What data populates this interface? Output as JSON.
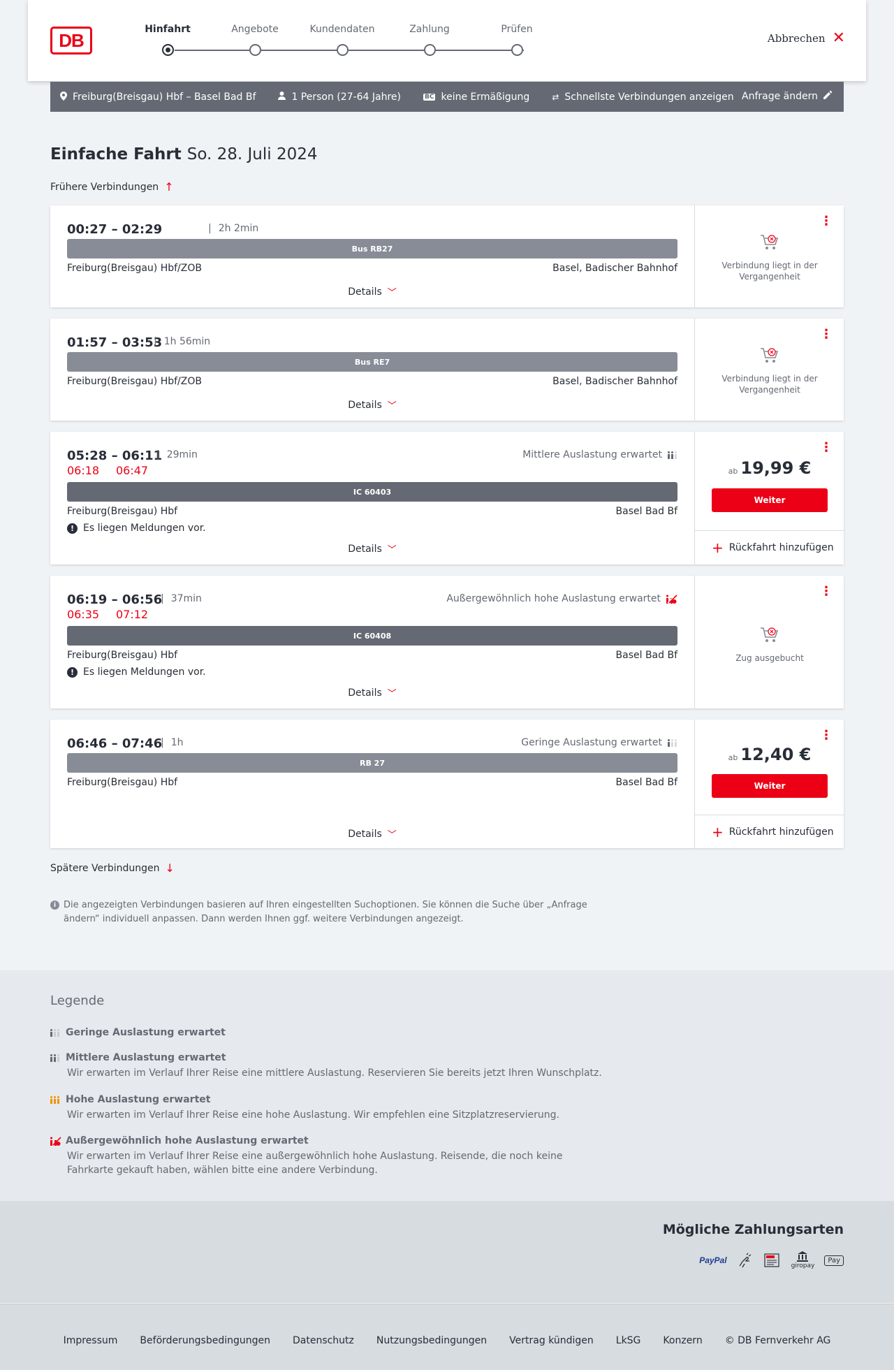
{
  "header": {
    "logo": "DB",
    "steps": [
      {
        "label": "Hinfahrt",
        "active": true
      },
      {
        "label": "Angebote",
        "active": false
      },
      {
        "label": "Kundendaten",
        "active": false
      },
      {
        "label": "Zahlung",
        "active": false
      },
      {
        "label": "Prüfen",
        "active": false
      }
    ],
    "cancel_label": "Abbrechen"
  },
  "search": {
    "route": "Freiburg(Breisgau) Hbf – Basel Bad Bf",
    "persons": "1 Person (27-64 Jahre)",
    "bc_badge": "BC",
    "discount": "keine Ermäßigung",
    "option": "Schnellste Verbindungen anzeigen",
    "change_label": "Anfrage ändern"
  },
  "title": {
    "trip_type": "Einfache Fahrt",
    "date": "So. 28. Juli 2024"
  },
  "earlier_label": "Frühere Verbindungen",
  "later_label": "Spätere Verbindungen",
  "connections": [
    {
      "times": "00:27 – 02:29",
      "duration": "2h 2min",
      "train": "Bus RB27",
      "from": "Freiburg(Breisgau) Hbf/ZOB",
      "to": "Basel, Badischer Bahnhof",
      "details": "Details",
      "status": "Verbindung liegt in der Vergangenheit"
    },
    {
      "times": "01:57 – 03:53",
      "duration": "1h 56min",
      "train": "Bus RE7",
      "from": "Freiburg(Breisgau) Hbf/ZOB",
      "to": "Basel, Badischer Bahnhof",
      "details": "Details",
      "status": "Verbindung liegt in der Vergangenheit"
    },
    {
      "times": "05:28 – 06:11",
      "duration": "29min",
      "delay_dep": "06:18",
      "delay_arr": "06:47",
      "occupancy": "Mittlere Auslastung erwartet",
      "train": "IC 60403",
      "from": "Freiburg(Breisgau) Hbf",
      "to": "Basel Bad Bf",
      "message": "Es liegen Meldungen vor.",
      "details": "Details",
      "price_prefix": "ab",
      "price": "19,99 €",
      "button": "Weiter",
      "return_label": "Rückfahrt hinzufügen"
    },
    {
      "times": "06:19 – 06:56",
      "duration": "37min",
      "delay_dep": "06:35",
      "delay_arr": "07:12",
      "occupancy": "Außergewöhnlich hohe Auslastung erwartet",
      "train": "IC 60408",
      "from": "Freiburg(Breisgau) Hbf",
      "to": "Basel Bad Bf",
      "message": "Es liegen Meldungen vor.",
      "details": "Details",
      "status": "Zug ausgebucht"
    },
    {
      "times": "06:46 – 07:46",
      "duration": "1h",
      "occupancy": "Geringe Auslastung erwartet",
      "train": "RB 27",
      "from": "Freiburg(Breisgau) Hbf",
      "to": "Basel Bad Bf",
      "details": "Details",
      "price_prefix": "ab",
      "price": "12,40 €",
      "button": "Weiter",
      "return_label": "Rückfahrt hinzufügen"
    }
  ],
  "info_text": "Die angezeigten Verbindungen basieren auf Ihren eingestellten Suchoptionen. Sie können die Suche über „Anfrage ändern“ individuell anpassen. Dann werden Ihnen ggf. weitere Verbindungen angezeigt.",
  "legend": {
    "title": "Legende",
    "items": [
      {
        "title": "Geringe Auslastung erwartet",
        "desc": ""
      },
      {
        "title": "Mittlere Auslastung erwartet",
        "desc": "Wir erwarten im Verlauf Ihrer Reise eine mittlere Auslastung. Reservieren Sie bereits jetzt Ihren Wunschplatz."
      },
      {
        "title": "Hohe Auslastung erwartet",
        "desc": "Wir erwarten im Verlauf Ihrer Reise eine hohe Auslastung. Wir empfehlen eine Sitzplatzreservierung."
      },
      {
        "title": "Außergewöhnlich hohe Auslastung erwartet",
        "desc": "Wir erwarten im Verlauf Ihrer Reise eine außergewöhnlich hohe Auslastung. Reisende, die noch keine Fahrkarte gekauft haben, wählen bitte eine andere Verbindung."
      }
    ]
  },
  "payments": {
    "title": "Mögliche Zahlungsarten",
    "methods": [
      "PayPal",
      "SEPA",
      "giropay",
      "Pay"
    ]
  },
  "footer": {
    "links": [
      "Impressum",
      "Beförderungsbedingungen",
      "Datenschutz",
      "Nutzungsbedingungen",
      "Vertrag kündigen",
      "LkSG",
      "Konzern",
      "© DB Fernverkehr AG"
    ]
  },
  "colors": {
    "accent": "#ec0016",
    "bar": "#646973",
    "bar_light": "#878c96",
    "occ_high": "#f39200"
  }
}
